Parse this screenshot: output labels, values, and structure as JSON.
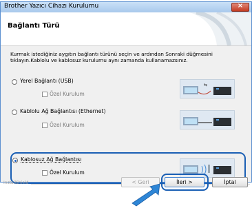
{
  "window": {
    "title": "Brother Yazıcı Cihazı Kurulumu",
    "close_label": "×"
  },
  "header": {
    "title": "Bağlantı Türü"
  },
  "instructions": "Kurmak istediğiniz aygıtın bağlantı türünü seçin ve ardından Sonraki düğmesini tıklayın.Kablolu ve kablosuz kurulumu aynı zamanda kullanamazsınız.",
  "options": [
    {
      "label": "Yerel Bağlantı (USB)",
      "checked": false,
      "custom_label": "Özel Kurulum",
      "custom_enabled": false,
      "icon": "usb-connection-illustration"
    },
    {
      "label": "Kablolu Ağ Bağlantısı (Ethernet)",
      "checked": false,
      "custom_label": "Özel Kurulum",
      "custom_enabled": false,
      "icon": "ethernet-connection-illustration"
    },
    {
      "label": "Kablosuz Ağ Bağlantısı",
      "checked": true,
      "custom_label": "Özel Kurulum",
      "custom_enabled": true,
      "icon": "wireless-connection-illustration"
    }
  ],
  "footer": {
    "watermark": "InstallShield"
  },
  "buttons": {
    "back": "< Geri",
    "next": "İleri >",
    "cancel": "İptal"
  },
  "colors": {
    "highlight": "#1a5fb4",
    "accent_arrow": "#2e86d6"
  }
}
